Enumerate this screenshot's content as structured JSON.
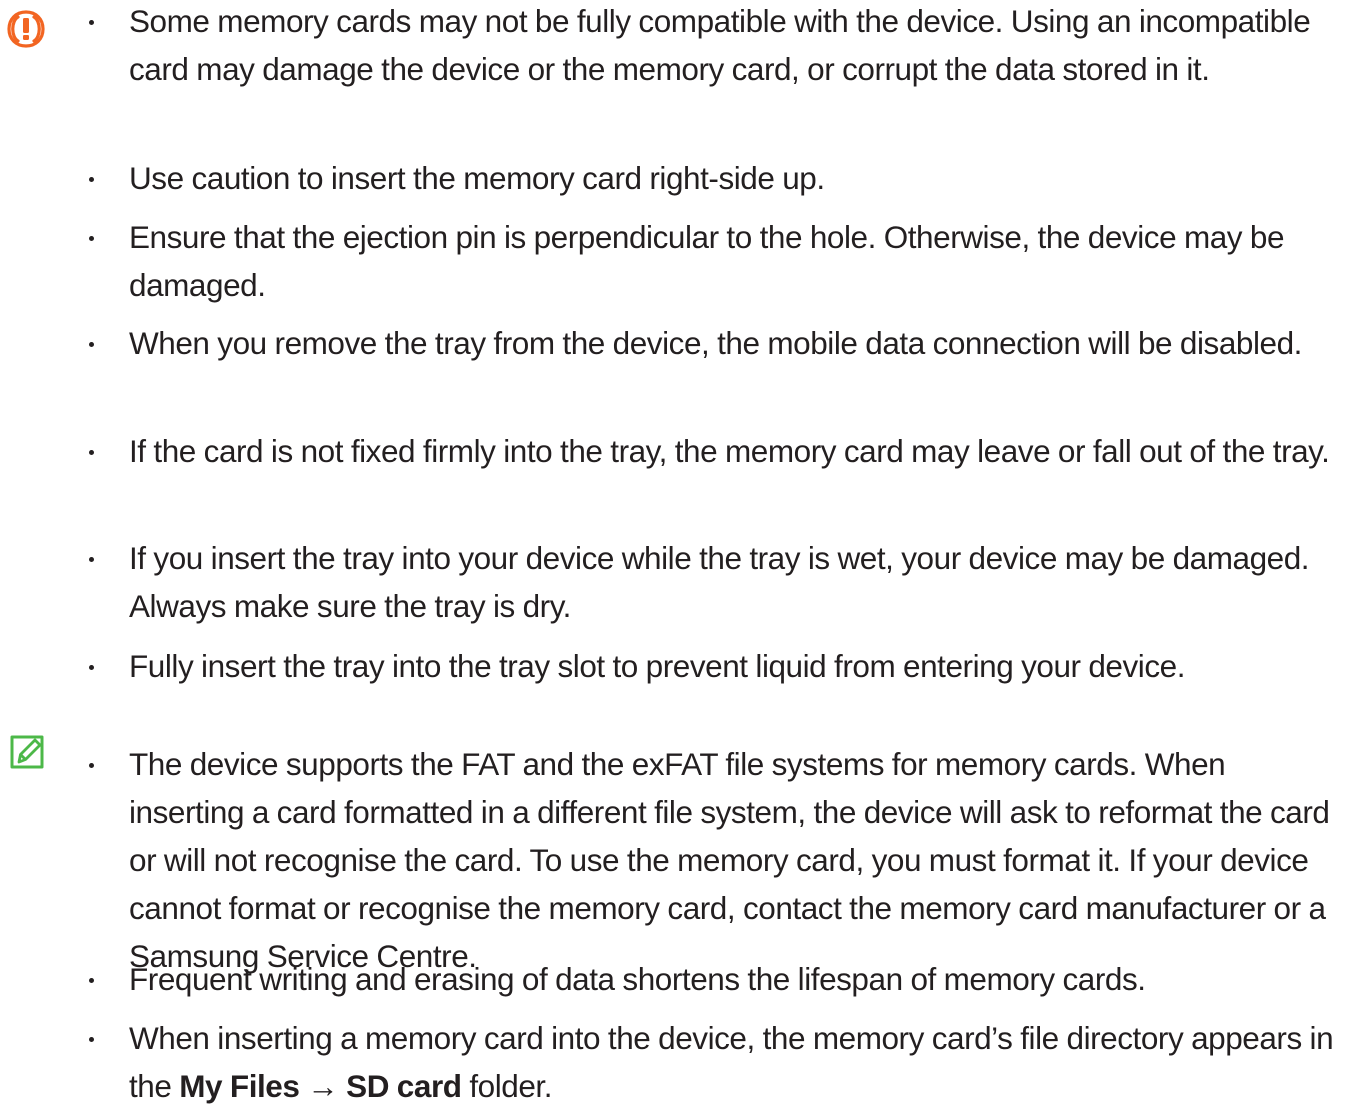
{
  "caution": {
    "icon": "caution-icon",
    "icon_color": "#f26522",
    "items": [
      "Some memory cards may not be fully compatible with the device. Using an incompatible card may damage the device or the memory card, or corrupt the data stored in it.",
      "Use caution to insert the memory card right-side up.",
      "Ensure that the ejection pin is perpendicular to the hole. Otherwise, the device may be damaged.",
      "When you remove the tray from the device, the mobile data connection will be disabled.",
      "If the card is not fixed firmly into the tray, the memory card may leave or fall out of the tray.",
      "If you insert the tray into your device while the tray is wet, your device may be damaged. Always make sure the tray is dry.",
      "Fully insert the tray into the tray slot to prevent liquid from entering your device."
    ]
  },
  "note": {
    "icon": "note-icon",
    "icon_color": "#4cb848",
    "items": [
      "The device supports the FAT and the exFAT file systems for memory cards. When inserting a card formatted in a different file system, the device will ask to reformat the card or will not recognise the card. To use the memory card, you must format it. If your device cannot format or recognise the memory card, contact the memory card manufacturer or a Samsung Service Centre.",
      "Frequent writing and erasing of data shortens the lifespan of memory cards."
    ],
    "last_item": {
      "prefix": "When inserting a memory card into the device, the memory card’s file directory appears in the ",
      "path_start": "My Files",
      "arrow": "→",
      "path_end": "SD card",
      "suffix": " folder."
    }
  }
}
